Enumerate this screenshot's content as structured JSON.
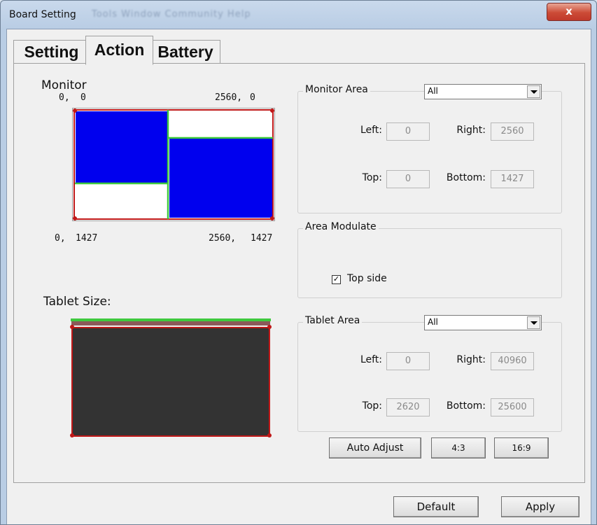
{
  "window": {
    "title": "Board Setting",
    "ghost_menu": "Tools   Window   Community   Help",
    "close_glyph": "x"
  },
  "tabs": [
    {
      "label": "Setting",
      "active": false
    },
    {
      "label": "Action",
      "active": true
    },
    {
      "label": "Battery",
      "active": false
    }
  ],
  "monitor": {
    "label": "Monitor",
    "tl_x": "0,",
    "tl_y": "0",
    "tr_x": "2560,",
    "tr_y": "0",
    "bl_x": "0,",
    "bl_y": "1427",
    "br_x": "2560,",
    "br_y": "1427"
  },
  "tablet": {
    "label": "Tablet Size:"
  },
  "monitor_area": {
    "label": "Monitor Area",
    "selected": "All",
    "left_label": "Left:",
    "left_value": "0",
    "right_label": "Right:",
    "right_value": "2560",
    "top_label": "Top:",
    "top_value": "0",
    "bottom_label": "Bottom:",
    "bottom_value": "1427"
  },
  "area_modulate": {
    "label": "Area Modulate",
    "checkbox_label": "Top side",
    "checked": true,
    "check_glyph": "✓"
  },
  "tablet_area": {
    "label": "Tablet Area",
    "selected": "All",
    "left_label": "Left:",
    "left_value": "0",
    "right_label": "Right:",
    "right_value": "40960",
    "top_label": "Top:",
    "top_value": "2620",
    "bottom_label": "Bottom:",
    "bottom_value": "25600"
  },
  "buttons": {
    "auto_adjust": "Auto Adjust",
    "ratio_4_3": "4:3",
    "ratio_16_9": "16:9",
    "default": "Default",
    "apply": "Apply"
  },
  "colors": {
    "monitor_blue": "#0000ee",
    "border_red": "#c01818",
    "divider_green": "#3ec93e",
    "tablet_fill": "#333333"
  }
}
